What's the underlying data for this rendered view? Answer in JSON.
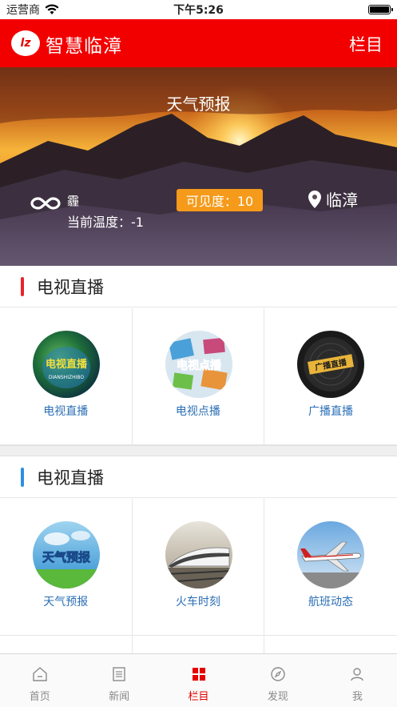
{
  "status_bar": {
    "carrier": "运营商",
    "time": "下午5:26"
  },
  "header": {
    "app_title": "智慧临漳",
    "menu_label": "栏目",
    "logo_text": "lz"
  },
  "weather": {
    "title": "天气预报",
    "condition": "霾",
    "temperature": "当前温度：-1",
    "visibility": "可见度：10",
    "location": "临漳"
  },
  "sections": [
    {
      "title": "电视直播",
      "accent": "#e8242b",
      "items": [
        {
          "label": "电视直播",
          "icon": "tv-live-icon",
          "overlay": "电视直播"
        },
        {
          "label": "电视点播",
          "icon": "tv-vod-icon",
          "overlay": "电视点播"
        },
        {
          "label": "广播直播",
          "icon": "radio-live-icon",
          "overlay": "广播直播"
        }
      ]
    },
    {
      "title": "电视直播",
      "accent": "#2f8fe0",
      "items": [
        {
          "label": "天气预报",
          "icon": "weather-forecast-icon",
          "overlay": "天气预报"
        },
        {
          "label": "火车时刻",
          "icon": "train-schedule-icon"
        },
        {
          "label": "航班动态",
          "icon": "flight-status-icon"
        }
      ]
    }
  ],
  "tabbar": {
    "items": [
      {
        "label": "首页",
        "icon": "home-icon"
      },
      {
        "label": "新闻",
        "icon": "news-icon"
      },
      {
        "label": "栏目",
        "icon": "columns-grid-icon",
        "active": true
      },
      {
        "label": "发现",
        "icon": "compass-icon"
      },
      {
        "label": "我",
        "icon": "user-icon"
      }
    ]
  },
  "colors": {
    "brand_red": "#f20000",
    "visibility_badge": "#f59a1a",
    "link_blue": "#2b6fb5"
  }
}
